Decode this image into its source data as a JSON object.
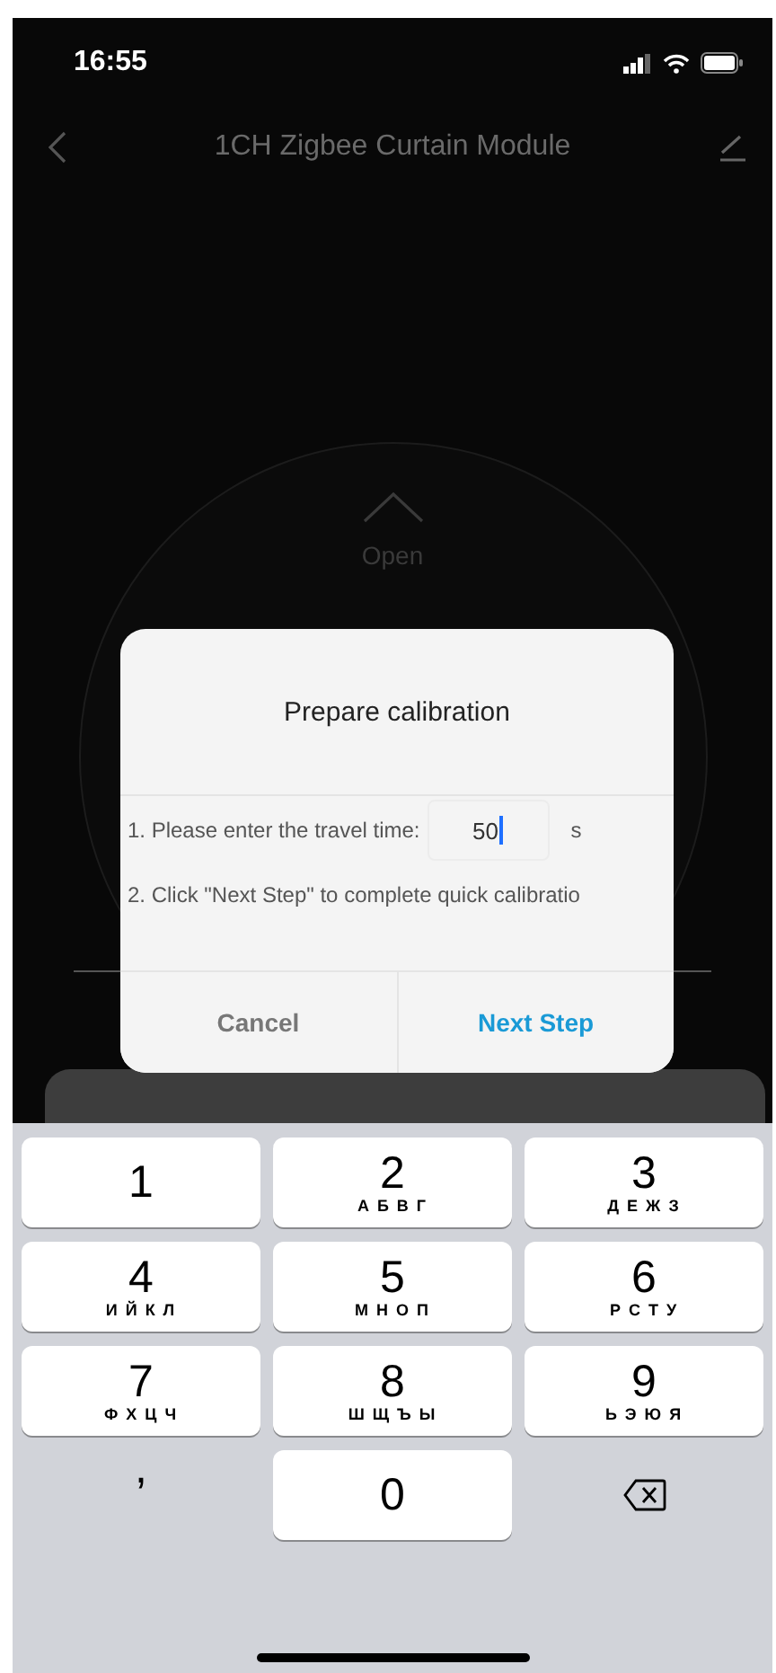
{
  "status_bar": {
    "time": "16:55"
  },
  "header": {
    "title": "1CH Zigbee Curtain Module"
  },
  "control": {
    "open_label": "Open"
  },
  "dialog": {
    "title": "Prepare calibration",
    "steps": [
      {
        "kind": "input",
        "text": "1. Please enter the travel time:",
        "value": "50",
        "unit": "s"
      },
      {
        "kind": "text",
        "text": "2. Click \"Next Step\" to complete quick calibratio"
      }
    ],
    "buttons": [
      {
        "label": "Cancel",
        "kind": "secondary"
      },
      {
        "label": "Next Step",
        "kind": "primary"
      }
    ]
  },
  "keypad": {
    "keys": [
      {
        "kind": "digit",
        "digit": "1"
      },
      {
        "kind": "digit",
        "digit": "2",
        "letters": "А Б В Г"
      },
      {
        "kind": "digit",
        "digit": "3",
        "letters": "Д Е Ж З"
      },
      {
        "kind": "digit",
        "digit": "4",
        "letters": "И Й К Л"
      },
      {
        "kind": "digit",
        "digit": "5",
        "letters": "М Н О П"
      },
      {
        "kind": "digit",
        "digit": "6",
        "letters": "Р С Т У"
      },
      {
        "kind": "digit",
        "digit": "7",
        "letters": "Ф Х Ц Ч"
      },
      {
        "kind": "digit",
        "digit": "8",
        "letters": "Ш Щ Ъ Ы"
      },
      {
        "kind": "digit",
        "digit": "9",
        "letters": "Ь Э Ю Я"
      },
      {
        "kind": "symbol",
        "digit": ","
      },
      {
        "kind": "digit",
        "digit": "0"
      },
      {
        "kind": "delete"
      }
    ]
  }
}
